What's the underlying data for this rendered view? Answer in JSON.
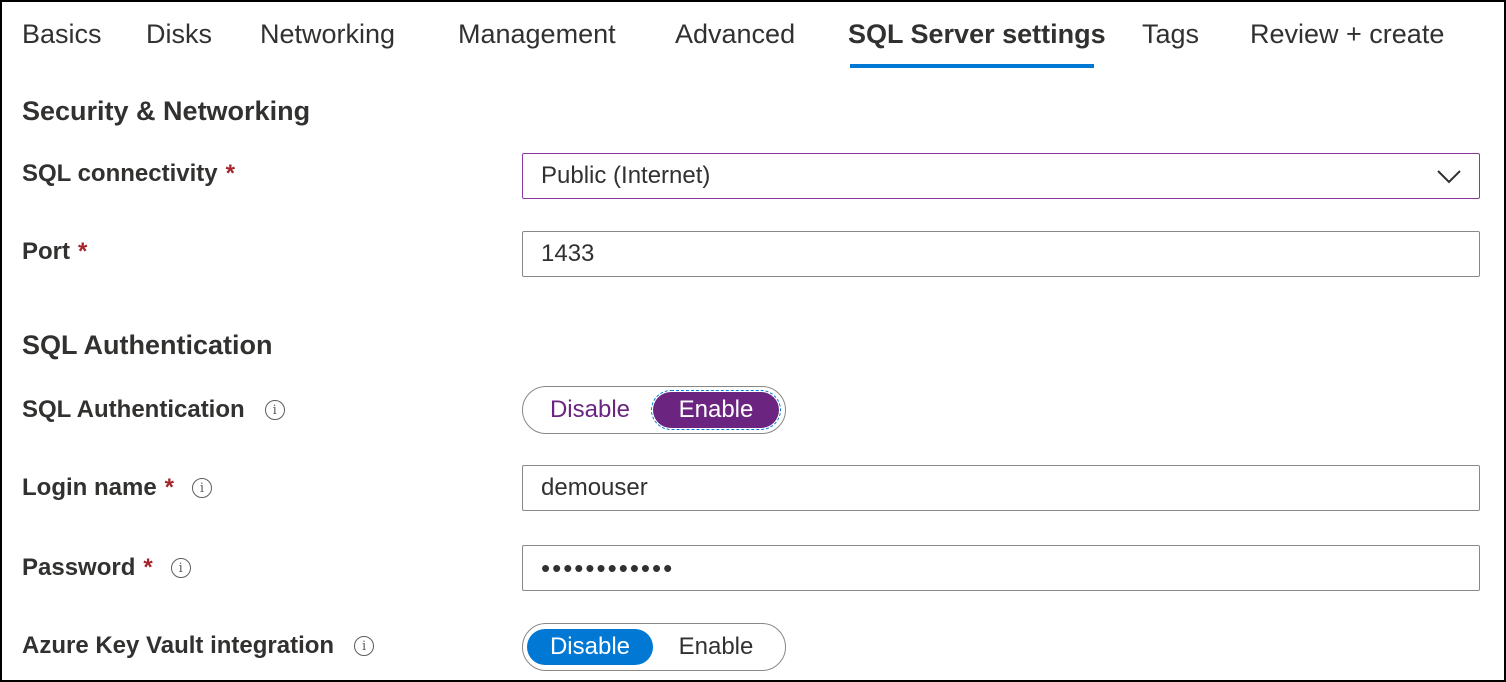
{
  "tabs": [
    {
      "label": "Basics",
      "active": false
    },
    {
      "label": "Disks",
      "active": false
    },
    {
      "label": "Networking",
      "active": false
    },
    {
      "label": "Management",
      "active": false
    },
    {
      "label": "Advanced",
      "active": false
    },
    {
      "label": "SQL Server settings",
      "active": true
    },
    {
      "label": "Tags",
      "active": false
    },
    {
      "label": "Review + create",
      "active": false
    }
  ],
  "security": {
    "heading": "Security & Networking",
    "connectivity": {
      "label": "SQL connectivity",
      "required": "*",
      "value": "Public (Internet)"
    },
    "port": {
      "label": "Port",
      "required": "*",
      "value": "1433"
    }
  },
  "auth": {
    "heading": "SQL Authentication",
    "sql_auth": {
      "label": "SQL Authentication",
      "info": "i",
      "options": [
        "Disable",
        "Enable"
      ],
      "selected": "Enable"
    },
    "login": {
      "label": "Login name",
      "required": "*",
      "info": "i",
      "value": "demouser"
    },
    "password": {
      "label": "Password",
      "required": "*",
      "info": "i",
      "value": "••••••••••••"
    },
    "key_vault": {
      "label": "Azure Key Vault integration",
      "info": "i",
      "options": [
        "Disable",
        "Enable"
      ],
      "selected": "Disable"
    }
  },
  "colors": {
    "accent": "#0078d4",
    "purple": "#6b2581",
    "required": "#a4262c"
  },
  "icons": {
    "chevron": "chevron-down-icon",
    "info": "info-icon"
  }
}
